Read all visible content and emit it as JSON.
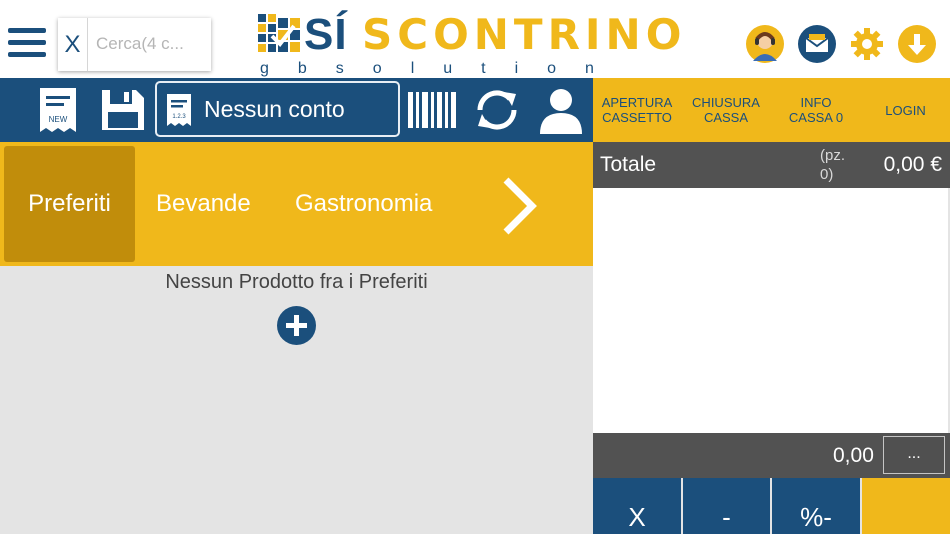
{
  "header": {
    "search_clear": "X",
    "search_placeholder": "Cerca(4 c...",
    "logo_si": "SÍ",
    "logo_rest": "SCONTRINO",
    "logo_sub": "gbsolution"
  },
  "toolbar": {
    "account_label": "Nessun conto",
    "new_label": "NEW",
    "account_icon_label": "1.2.3"
  },
  "top_menu": [
    {
      "label": "APERTURA\nCASSETTO"
    },
    {
      "label": "CHIUSURA\nCASSA"
    },
    {
      "label": "INFO\nCASSA 0"
    },
    {
      "label": "LOGIN"
    }
  ],
  "categories": {
    "active": "Preferiti",
    "items": [
      "Bevande",
      "Gastronomia"
    ]
  },
  "main": {
    "empty_message": "Nessun Prodotto fra i Preferiti"
  },
  "receipt": {
    "total_label": "Totale",
    "pieces": "(pz.\n0)",
    "total_amount": "0,00 €",
    "bottom_amount": "0,00",
    "more_label": "..."
  },
  "keypad": [
    "X",
    "-",
    "%-"
  ],
  "colors": {
    "brand_blue": "#1b4f7c",
    "brand_yellow": "#f0b81b",
    "active_category": "#c18d0b",
    "dark_bar": "#525252"
  }
}
